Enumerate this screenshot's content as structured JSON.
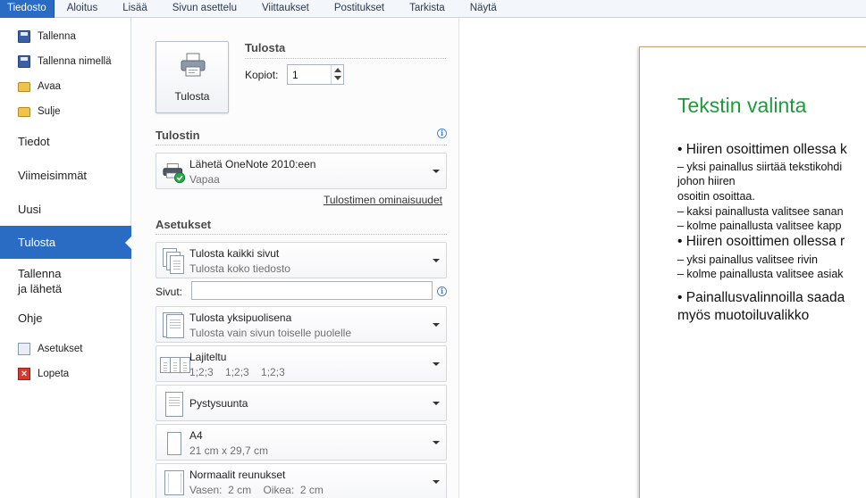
{
  "ribbon": {
    "tabs": [
      "Tiedosto",
      "Aloitus",
      "Lisää",
      "Sivun asettelu",
      "Viittaukset",
      "Postitukset",
      "Tarkista",
      "Näytä"
    ]
  },
  "nav": {
    "commands": [
      {
        "label": "Tallenna",
        "icon": "save-icon"
      },
      {
        "label": "Tallenna nimellä",
        "icon": "save-as-icon"
      },
      {
        "label": "Avaa",
        "icon": "open-folder-icon"
      },
      {
        "label": "Sulje",
        "icon": "close-folder-icon"
      }
    ],
    "sections": [
      {
        "label": "Tiedot"
      },
      {
        "label": "Viimeisimmät"
      },
      {
        "label": "Uusi"
      },
      {
        "label": "Tulosta",
        "active": true
      },
      {
        "label": "Tallenna\nja lähetä"
      },
      {
        "label": "Ohje"
      }
    ],
    "footer": [
      {
        "label": "Asetukset",
        "icon": "options-icon"
      },
      {
        "label": "Lopeta",
        "icon": "exit-icon"
      }
    ]
  },
  "print": {
    "heading": "Tulosta",
    "button_label": "Tulosta",
    "copies_label": "Kopiot:",
    "copies_value": "1"
  },
  "printer": {
    "heading": "Tulostin",
    "name": "Lähetä OneNote 2010:een",
    "status": "Vapaa",
    "properties_link": "Tulostimen ominaisuudet"
  },
  "settings": {
    "heading": "Asetukset",
    "pages_label": "Sivut:",
    "pages_value": "",
    "dropdowns": [
      {
        "line1": "Tulosta kaikki sivut",
        "line2": "Tulosta koko tiedosto"
      },
      {
        "line1": "Tulosta yksipuolisena",
        "line2": "Tulosta vain sivun toiselle puolelle"
      },
      {
        "line1": "Lajiteltu",
        "line2": "1;2;3    1;2;3    1;2;3"
      },
      {
        "line1": "Pystysuunta",
        "line2": ""
      },
      {
        "line1": "A4",
        "line2": "21 cm x 29,7 cm"
      },
      {
        "line1": "Normaalit reunukset",
        "line2": "Vasen:  2 cm    Oikea:  2 cm"
      }
    ]
  },
  "preview": {
    "title": "Tekstin valinta",
    "lines": [
      "• Hiiren osoittimen ollessa k",
      "– yksi painallus siirtää tekstikohdi",
      "johon hiiren",
      "osoitin osoittaa.",
      "– kaksi painallusta valitsee sanan",
      "– kolme painallusta valitsee kapp",
      "• Hiiren osoittimen ollessa r",
      "– yksi painallus valitsee rivin",
      "– kolme painallusta valitsee asiak",
      "• Painallusvalinnoilla saada",
      "myös muotoiluvalikko"
    ],
    "title_color": "#1f9a3c"
  },
  "colors": {
    "accent": "#2a6bc3"
  }
}
